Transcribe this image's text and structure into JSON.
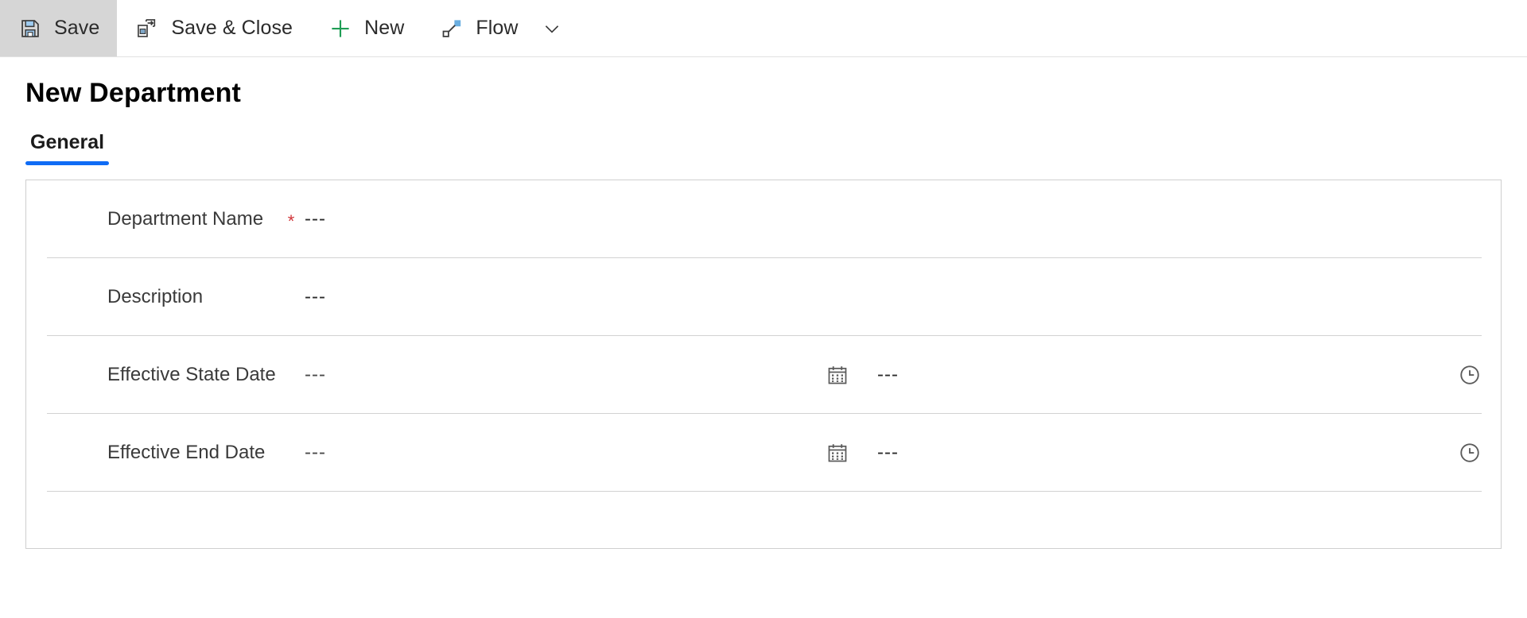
{
  "command_bar": {
    "buttons": [
      {
        "id": "save",
        "label": "Save",
        "icon": "save-icon",
        "active": true
      },
      {
        "id": "save-close",
        "label": "Save & Close",
        "icon": "save-and-close-icon",
        "active": false
      },
      {
        "id": "new",
        "label": "New",
        "icon": "plus-icon",
        "active": false
      },
      {
        "id": "flow",
        "label": "Flow",
        "icon": "flow-icon",
        "active": false
      }
    ],
    "overflow_icon": "chevron-down-icon"
  },
  "page": {
    "title": "New Department"
  },
  "tabs": [
    {
      "label": "General",
      "selected": true
    }
  ],
  "form": {
    "rows": [
      {
        "label": "Department Name",
        "required": true,
        "required_marker": "*",
        "value": "---",
        "has_date_controls": false
      },
      {
        "label": "Description",
        "required": false,
        "required_marker": "",
        "value": "---",
        "has_date_controls": false
      },
      {
        "label": "Effective State Date",
        "required": false,
        "required_marker": "",
        "value": "---",
        "has_date_controls": true,
        "calendar_icon": "calendar-icon",
        "time_value": "---",
        "clock_icon": "clock-icon"
      },
      {
        "label": "Effective End Date",
        "required": false,
        "required_marker": "",
        "value": "---",
        "has_date_controls": true,
        "calendar_icon": "calendar-icon",
        "time_value": "---",
        "clock_icon": "clock-icon"
      }
    ]
  },
  "colors": {
    "tab_accent": "#0f6cf5",
    "required_star": "#d13438",
    "new_icon": "#107c41",
    "icon_blue": "#5b9bd5",
    "active_button_bg": "#d6d6d6"
  }
}
